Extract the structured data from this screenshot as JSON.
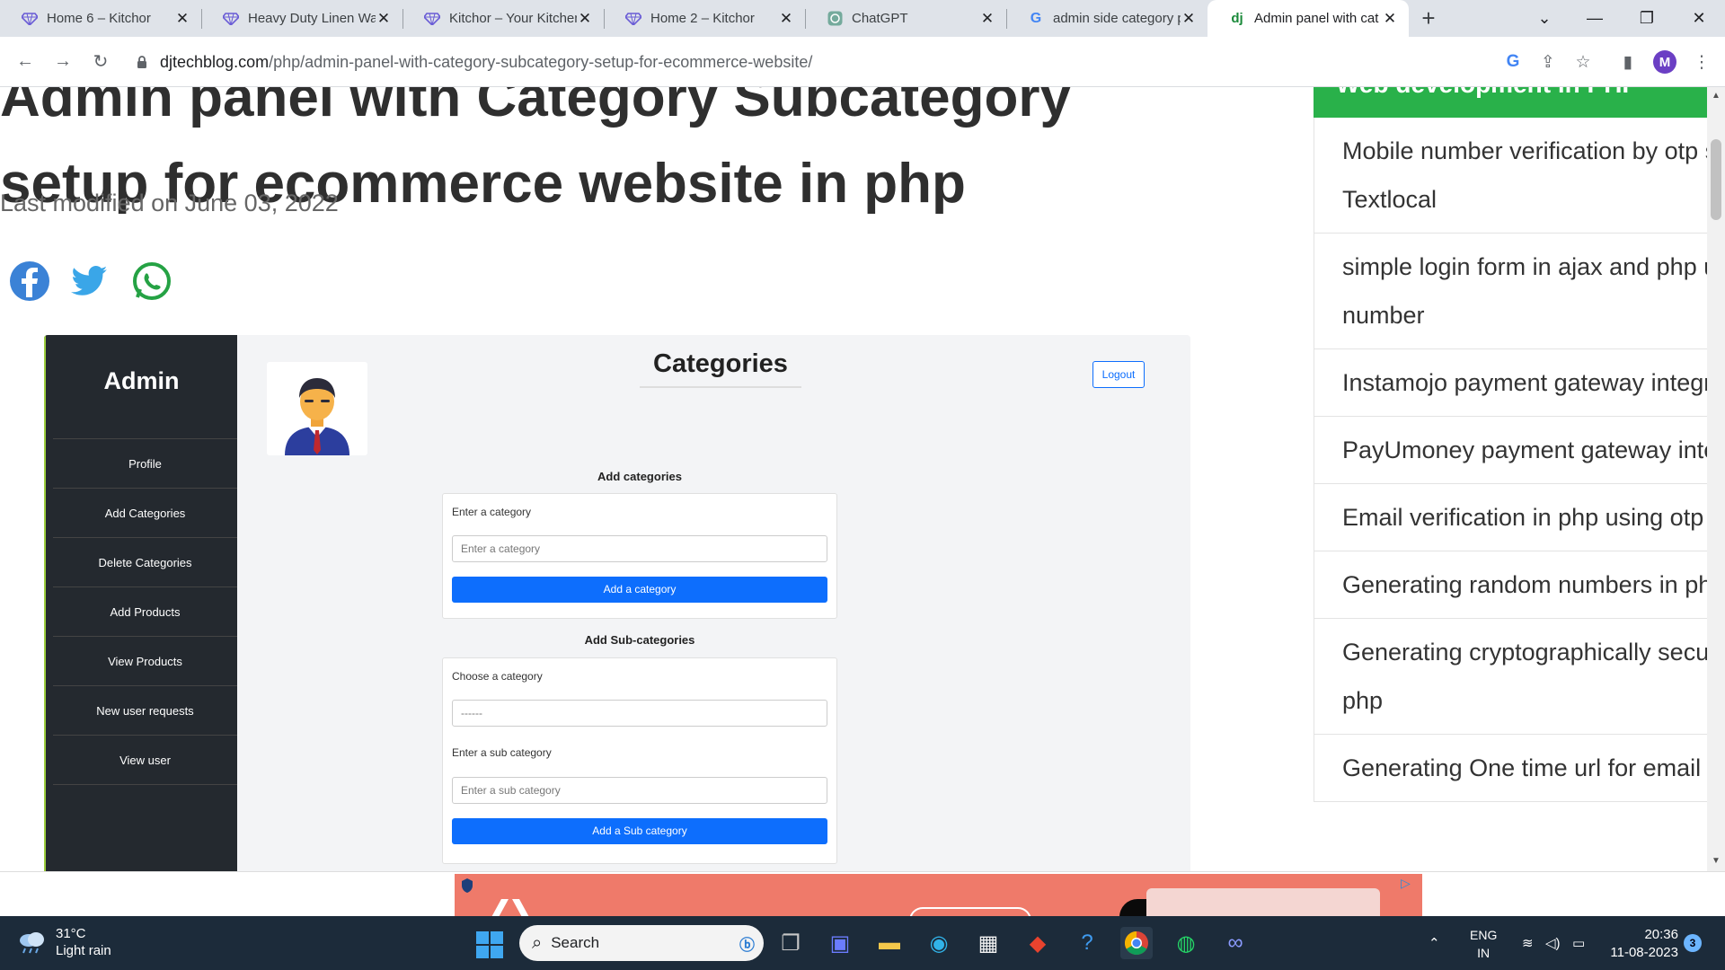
{
  "browser": {
    "tabs": [
      {
        "title": "Home 6 – Kitchor",
        "favicon": "diamond-icon",
        "active": false
      },
      {
        "title": "Heavy Duty Linen Wat",
        "favicon": "diamond-icon",
        "active": false
      },
      {
        "title": "Kitchor – Your Kitchen",
        "favicon": "diamond-icon",
        "active": false
      },
      {
        "title": "Home 2 – Kitchor",
        "favicon": "diamond-icon",
        "active": false
      },
      {
        "title": "ChatGPT",
        "favicon": "chatgpt-icon",
        "active": false
      },
      {
        "title": "admin side category p",
        "favicon": "google-icon",
        "active": false
      },
      {
        "title": "Admin panel with cat",
        "favicon": "dj-icon",
        "active": true
      }
    ],
    "favicon_text": {
      "dj": "dj",
      "google": "G"
    },
    "address": {
      "domain": "djtechblog.com",
      "path": "/php/admin-panel-with-category-subcategory-setup-for-ecommerce-website/"
    },
    "profile_initial": "M"
  },
  "article": {
    "title_line1": "Admin panel with Category Subcategory",
    "title_line2": "setup for ecommerce website in php",
    "modified": "Last modified on June 03, 2022"
  },
  "admin_screenshot": {
    "brand": "Admin",
    "menu": [
      "Profile",
      "Add Categories",
      "Delete Categories",
      "Add Products",
      "View Products",
      "New user requests",
      "View user"
    ],
    "heading": "Categories",
    "logout": "Logout",
    "add_categories": {
      "title": "Add categories",
      "label": "Enter a category",
      "placeholder": "Enter a category",
      "button": "Add a category"
    },
    "add_subcategories": {
      "title": "Add Sub-categories",
      "choose_label": "Choose a category",
      "choose_value": "------",
      "sub_label": "Enter a sub category",
      "sub_placeholder": "Enter a sub category",
      "button": "Add a Sub category"
    }
  },
  "sidebar": {
    "header": "Web development in PHP",
    "items": [
      "Mobile number verification by otp s",
      "Textlocal",
      "simple login form in ajax and php u",
      "number",
      "Instamojo payment gateway integr",
      "PayUmoney payment gateway inte",
      "Email verification in php using otp",
      "Generating random numbers in ph",
      "Generating cryptographically secu",
      "php",
      "Generating One time url for email v"
    ]
  },
  "taskbar": {
    "temperature": "31°C",
    "weather": "Light rain",
    "search_placeholder": "Search",
    "language": "ENG",
    "region": "IN",
    "time": "20:36",
    "date": "11-08-2023",
    "notification_count": "3"
  },
  "colors": {
    "accent_green": "#29b14a",
    "admin_sidebar": "#24292f",
    "button_blue": "#0d6efd",
    "taskbar": "#1c2b3a"
  }
}
